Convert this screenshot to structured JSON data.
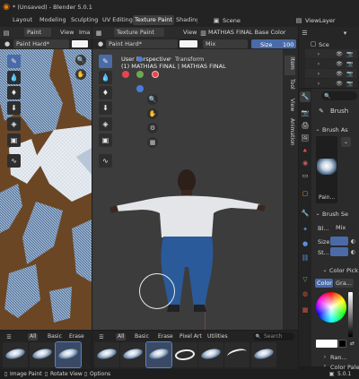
{
  "window": {
    "title": "* (Unsaved) - Blender 5.0.1",
    "app_icon": "blender-icon"
  },
  "workspace_tabs": [
    "Layout",
    "Modeling",
    "Sculpting",
    "UV Editing",
    "Texture Paint",
    "Shading"
  ],
  "active_tab": "Texture Paint",
  "scene": {
    "label": "Scene",
    "view_layer": "ViewLayer"
  },
  "left_editor": {
    "mode": "Paint",
    "menus": [
      "View",
      "Ima"
    ],
    "brush": "Paint Hard*"
  },
  "viewport": {
    "mode": "Texture Paint",
    "menus": [
      "View"
    ],
    "active_paint": "MATHIAS FINAL Base Color",
    "brush": "Paint Hard*",
    "blend": "Mix",
    "size_label": "Size",
    "size_value": "100",
    "perspective": "User Perspective",
    "object_info": "(1) MATHIAS FINAL | MATHIAS FINAL",
    "transform_label": "Transform",
    "n_panel_tabs": [
      "Item",
      "Tool",
      "View",
      "Animation"
    ],
    "axis_colors": {
      "x": "#e8444f",
      "y": "#6aa94c",
      "z": "#4b7cd9"
    }
  },
  "properties": {
    "brush_title": "Brush",
    "brush_asset_label": "Brush As",
    "brush_thumb_label": "Pain...",
    "brush_settings_label": "Brush Se",
    "blend_label": "Bl...",
    "blend_value": "Mix",
    "size_label": "Size",
    "strength_label": "St...",
    "color_picker_label": "Color Pick",
    "color_tab": "Color",
    "gradient_tab": "Gra...",
    "random_label": "Ran...",
    "color_palette_label": "Color Pale"
  },
  "asset_shelf": {
    "left_tabs": [
      "All",
      "Basic",
      "Erase"
    ],
    "right_tabs": [
      "All",
      "Basic",
      "Erase",
      "Pixel Art",
      "Utilities"
    ],
    "search_placeholder": "Search"
  },
  "status_bar": {
    "items": [
      "Image Paint",
      "Rotate View",
      "Options"
    ],
    "version": "5.0.1"
  },
  "outliner": {
    "search_label": "Sce"
  }
}
